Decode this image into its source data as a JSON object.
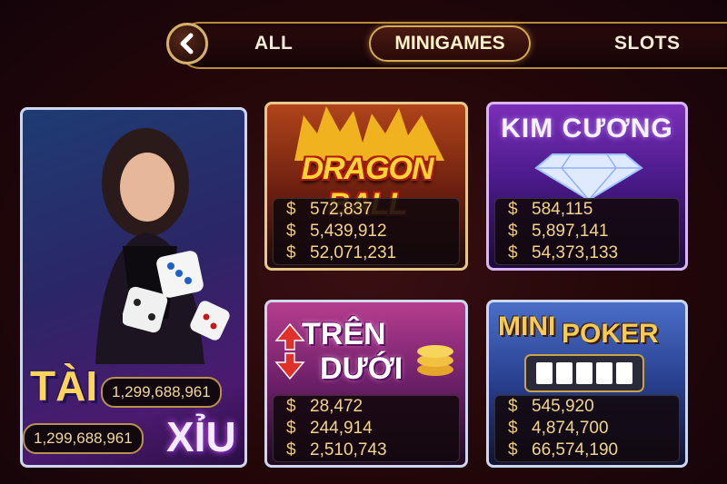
{
  "nav": {
    "back_icon": "chevron-left-icon",
    "tabs": [
      {
        "label": "ALL",
        "active": false
      },
      {
        "label": "MINIGAMES",
        "active": true
      },
      {
        "label": "SLOTS",
        "active": false
      }
    ]
  },
  "taixiu": {
    "tai_label": "TÀI",
    "xiu_label": "XỈU",
    "tai_amount": "1,299,688,961",
    "xiu_amount": "1,299,688,961"
  },
  "games": [
    {
      "title_line1": "DRAGON BALL",
      "jackpots": [
        "572,837",
        "5,439,912",
        "52,071,231"
      ]
    },
    {
      "title_line1": "KIM CƯƠNG",
      "jackpots": [
        "584,115",
        "5,897,141",
        "54,373,133"
      ]
    },
    {
      "title_line1": "TRÊN",
      "title_line2": "DƯỚI",
      "jackpots": [
        "28,472",
        "244,914",
        "2,510,743"
      ]
    },
    {
      "title_line1": "MINI",
      "title_line2": "POKER",
      "jackpots": [
        "545,920",
        "4,874,700",
        "66,574,190"
      ]
    }
  ],
  "currency_symbol": "$",
  "colors": {
    "gold": "#d6a955",
    "jackpot_text": "#f3d48a",
    "background": "#230709"
  }
}
